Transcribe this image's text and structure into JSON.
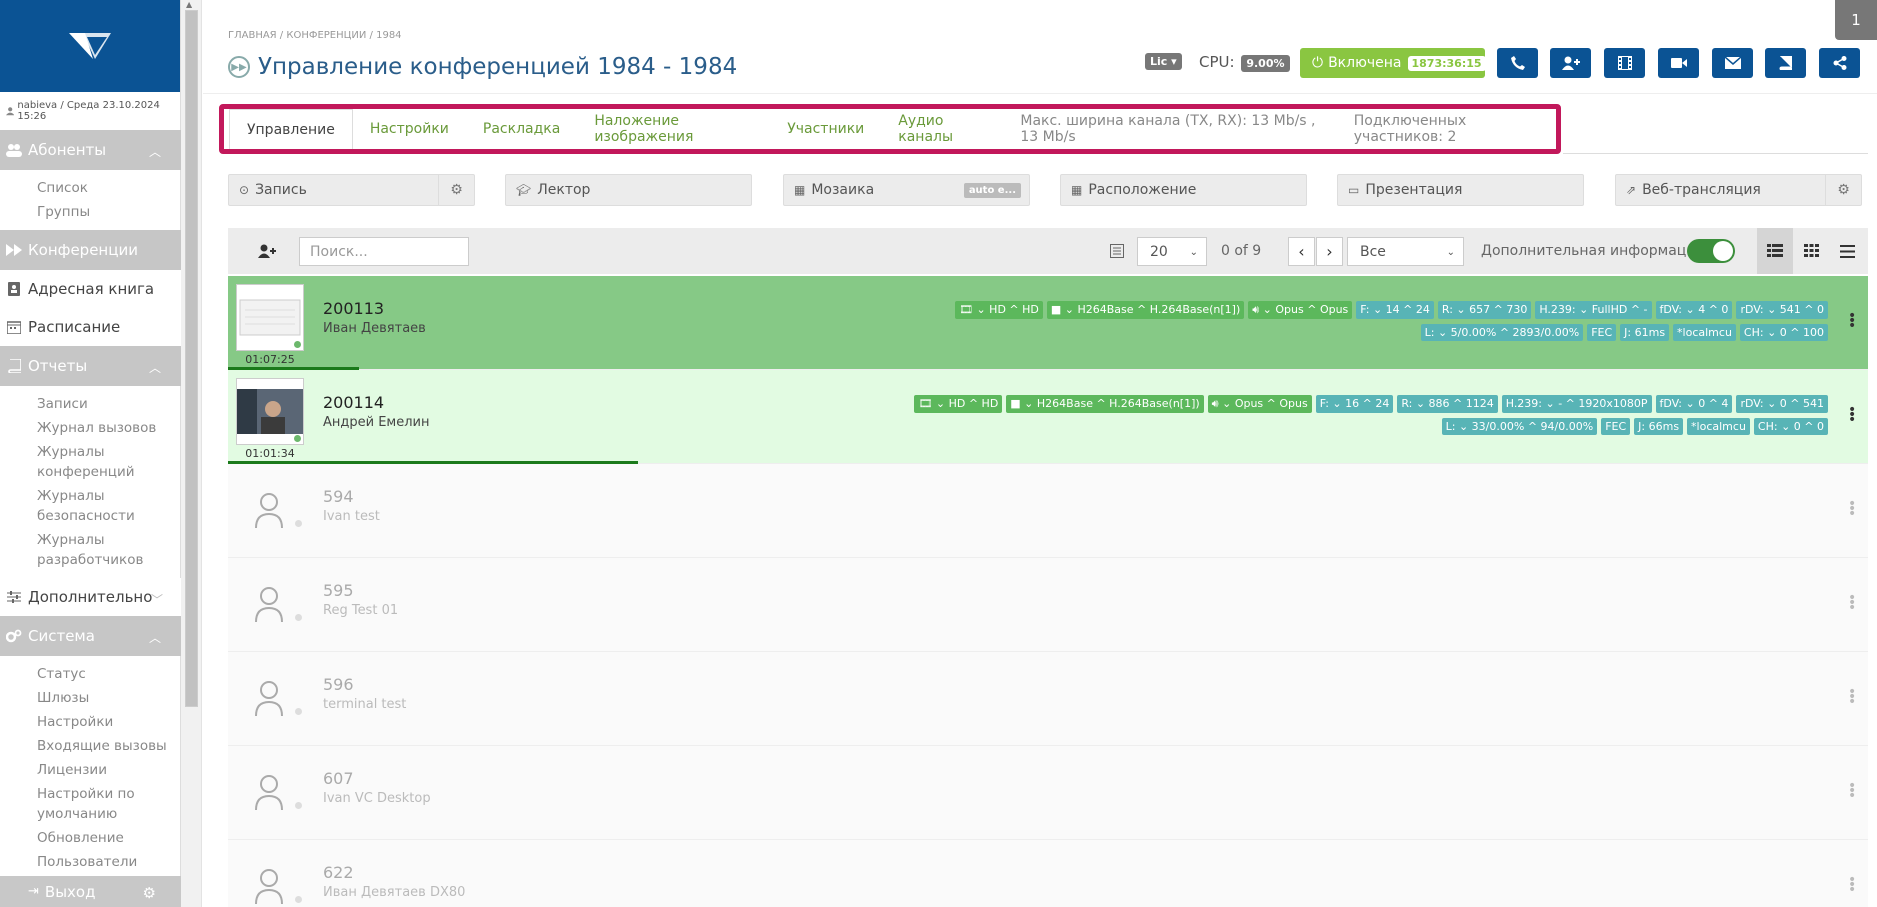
{
  "sidebar": {
    "user_info": "nabieva / Среда 23.10.2024 15:26",
    "groups": [
      {
        "label": "Абоненты",
        "icon": "users-icon",
        "items": [
          "Список",
          "Группы"
        ]
      },
      {
        "label": "Конференции",
        "icon": "forward-icon",
        "items": []
      },
      {
        "label": "Адресная книга",
        "icon": "address-book-icon",
        "items": []
      },
      {
        "label": "Расписание",
        "icon": "calendar-icon",
        "items": []
      },
      {
        "label": "Отчеты",
        "icon": "book-icon",
        "items": [
          "Записи",
          "Журнал вызовов",
          "Журналы конференций",
          "Журналы безопасности",
          "Журналы разработчиков"
        ]
      },
      {
        "label": "Дополнительно",
        "icon": "sliders-icon",
        "items": []
      },
      {
        "label": "Система",
        "icon": "cogs-icon",
        "items": [
          "Статус",
          "Шлюзы",
          "Настройки",
          "Входящие вызовы",
          "Лицензии",
          "Настройки по умолчанию",
          "Обновление",
          "Пользователи"
        ]
      }
    ],
    "logout_label": "Выход"
  },
  "header": {
    "breadcrumb": "ГЛАВНАЯ / КОНФЕРЕНЦИИ / 1984",
    "title": "Управление конференцией 1984 - 1984",
    "lic_label": "Lic",
    "cpu_label": "CPU:",
    "cpu_value": "9.00%",
    "status_label": "Включена",
    "status_time": "1873:36:15",
    "corner_number": "1",
    "action_icons": [
      "phone-icon",
      "add-user-icon",
      "film-icon",
      "video-camera-icon",
      "envelope-icon",
      "book-icon",
      "share-icon"
    ]
  },
  "tabs": {
    "items": [
      "Управление",
      "Настройки",
      "Раскладка",
      "Наложение изображения",
      "Участники",
      "Аудио каналы"
    ],
    "active_index": 0,
    "bandwidth": "Макс. ширина канала (TX, RX): 13 Mb/s , 13 Mb/s",
    "connected": "Подключенных участников: 2"
  },
  "controls": {
    "record": "Запись",
    "lector": "Лектор",
    "mosaic": "Мозаика",
    "mosaic_badge": "auto e...",
    "layout": "Расположение",
    "presentation": "Презентация",
    "webcast": "Веб-трансляция"
  },
  "toolbar": {
    "search_placeholder": "Поиск...",
    "page_size": "20",
    "page_count": "0 of 9",
    "filter": "Все",
    "additional_info": "Дополнительная информация",
    "additional_info_on": true
  },
  "participants": [
    {
      "number": "200113",
      "name": "Иван Девятаев",
      "time": "01:07:25",
      "state": "active",
      "progress": 0.08,
      "tags_line1": [
        "HD ^ HD",
        "H264Base ^ H.264Base(n[1])",
        "Opus ^ Opus",
        "F: ⌄ 14 ^ 24",
        "R: ⌄ 657 ^ 730",
        "H.239: ⌄ FullHD ^ -",
        "fDV: ⌄ 4 ^ 0",
        "rDV: ⌄ 541 ^ 0"
      ],
      "tags_line2": [
        "L: ⌄ 5/0.00% ^ 2893/0.00%",
        "FEC",
        "J: 61ms",
        "*localmcu",
        "CH: ⌄ 0 ^ 100"
      ]
    },
    {
      "number": "200114",
      "name": "Андрей Емелин",
      "time": "01:01:34",
      "state": "active2",
      "progress": 0.25,
      "tags_line1": [
        "HD ^ HD",
        "H264Base ^ H.264Base(n[1])",
        "Opus ^ Opus",
        "F: ⌄ 16 ^ 24",
        "R: ⌄ 886 ^ 1124",
        "H.239: ⌄ - ^ 1920x1080P",
        "fDV: ⌄ 0 ^ 4",
        "rDV: ⌄ 0 ^ 541"
      ],
      "tags_line2": [
        "L: ⌄ 33/0.00% ^ 94/0.00%",
        "FEC",
        "J: 66ms",
        "*localmcu",
        "CH: ⌄ 0 ^ 0"
      ]
    },
    {
      "number": "594",
      "name": "Ivan test",
      "state": "offline"
    },
    {
      "number": "595",
      "name": "Reg Test 01",
      "state": "offline"
    },
    {
      "number": "596",
      "name": "terminal test",
      "state": "offline"
    },
    {
      "number": "607",
      "name": "Ivan VC Desktop",
      "state": "offline"
    },
    {
      "number": "622",
      "name": "Иван Девятаев DX80",
      "state": "offline"
    }
  ],
  "colors": {
    "brand": "#0b5394",
    "status_on": "#8ac641",
    "highlight_border": "#c2185b",
    "row_active": "#86c986",
    "row_active2": "#e2fbe2",
    "tag": "#58b4b6"
  }
}
